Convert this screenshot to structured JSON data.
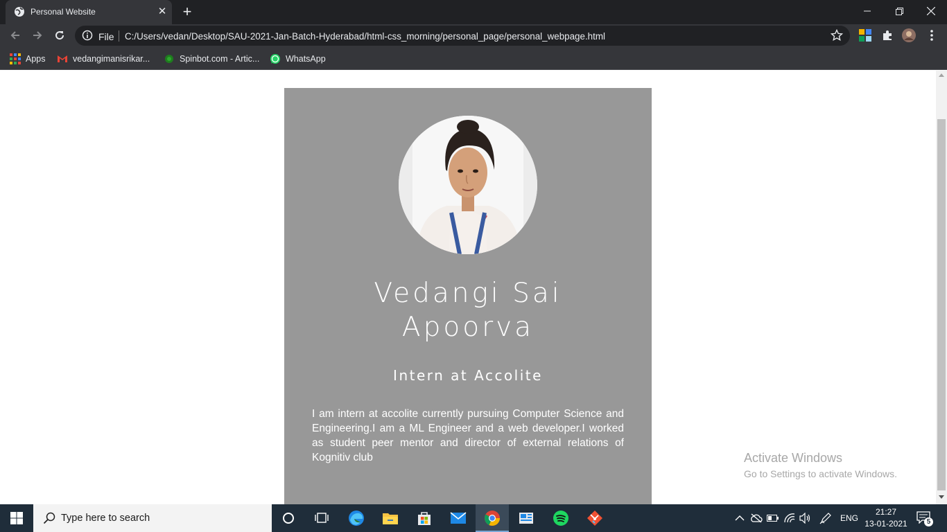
{
  "browser": {
    "tab_title": "Personal Website",
    "new_tab_symbol": "+",
    "close_symbol": "✕",
    "file_label": "File",
    "url": "C:/Users/vedan/Desktop/SAU-2021-Jan-Batch-Hyderabad/html-css_morning/personal_page/personal_webpage.html",
    "bookmarks": [
      {
        "label": "Apps",
        "icon": "apps-grid-icon"
      },
      {
        "label": "vedangimanisrikar...",
        "icon": "gmail-icon"
      },
      {
        "label": "Spinbot.com - Artic...",
        "icon": "spinbot-icon"
      },
      {
        "label": "WhatsApp",
        "icon": "whatsapp-icon"
      }
    ]
  },
  "profile": {
    "name_line1": "Vedangi Sai",
    "name_line2": "Apoorva",
    "title": "Intern at Accolite",
    "bio": "I am intern at accolite currently pursuing Computer Science and Engineering.I am a ML Engineer and a web developer.I worked as student peer mentor and director of external relations of Kognitiv club",
    "card_color": "#989898"
  },
  "windows_watermark": {
    "line1": "Activate Windows",
    "line2": "Go to Settings to activate Windows."
  },
  "taskbar": {
    "search_placeholder": "Type here to search",
    "apps": [
      "cortana-icon",
      "task-view-icon",
      "edge-icon",
      "file-explorer-icon",
      "store-icon",
      "mail-icon",
      "chrome-icon",
      "news-icon",
      "spotify-icon",
      "git-icon"
    ],
    "language": "ENG",
    "time": "21:27",
    "date": "13-01-2021",
    "notification_count": "5"
  }
}
